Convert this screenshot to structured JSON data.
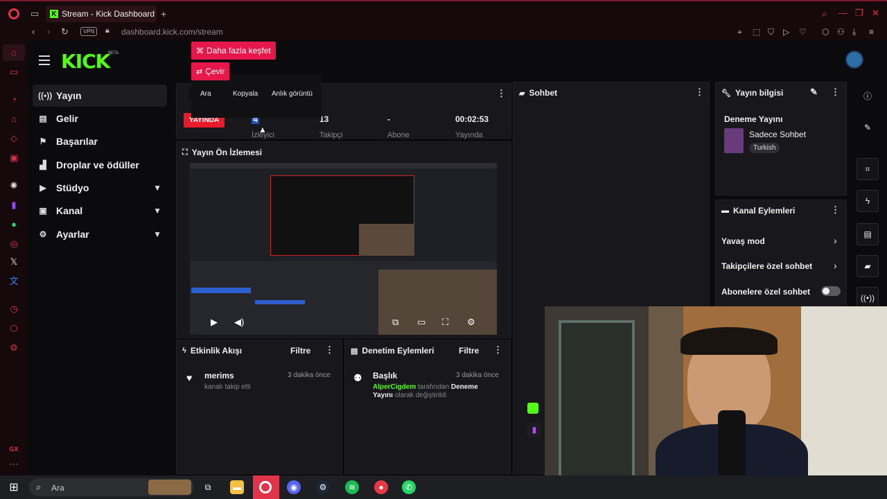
{
  "browser": {
    "tab_title": "Stream - Kick Dashboard",
    "tab_add": "+",
    "vpn_label": "VPN",
    "url": "dashboard.kick.com/stream"
  },
  "context_popup": {
    "explore_label": "Daha fazla keşfet",
    "translate_label": "Çevir",
    "search_label": "Ara",
    "copy_label": "Kopyala",
    "snapshot_label": "Anlık görüntü"
  },
  "kick": {
    "logo": "KICK",
    "beta": "BETA",
    "nav": [
      {
        "label": "Yayın",
        "icon": "broadcast-icon"
      },
      {
        "label": "Gelir",
        "icon": "chart-icon"
      },
      {
        "label": "Başarılar",
        "icon": "flag-icon"
      },
      {
        "label": "Droplar ve ödüller",
        "icon": "gift-icon"
      },
      {
        "label": "Stüdyo",
        "icon": "studio-icon"
      },
      {
        "label": "Kanal",
        "icon": "channel-icon"
      },
      {
        "label": "Ayarlar",
        "icon": "gear-icon"
      }
    ]
  },
  "stats": {
    "live_badge": "YAYINDA",
    "viewers_value": "4",
    "viewers_label": "İzleyici",
    "followers_value": "13",
    "followers_label": "Takipçi",
    "subs_value": "-",
    "subs_label": "Abone",
    "uptime_value": "00:02:53",
    "uptime_label": "Yayında"
  },
  "preview": {
    "title": "Yayın Ön İzlemesi"
  },
  "activity": {
    "title": "Etkinlik Akışı",
    "filter": "Filtre",
    "item_user": "merims",
    "item_action": "kanalı takip etti",
    "item_time": "3 dakika önce"
  },
  "moderation": {
    "title": "Denetim Eylemleri",
    "filter": "Filtre",
    "item_title": "Başlık",
    "item_time": "3 dakika önce",
    "item_user": "AlperCigdem",
    "item_by": "tarafından",
    "item_from": "Deneme",
    "item_new": "Yayını",
    "item_tail": "olarak değiştirildi"
  },
  "chat": {
    "title": "Sohbet"
  },
  "stream_info": {
    "title": "Yayın bilgisi",
    "stream_title": "Deneme Yayını",
    "category": "Sadece Sohbet",
    "language": "Turkish"
  },
  "channel_actions": {
    "title": "Kanal Eylemleri",
    "slow_mode": "Yavaş mod",
    "followers_only": "Takipçilere özel sohbet",
    "subs_only": "Abonelere özel sohbet",
    "subs_only_on": false
  },
  "taskbar": {
    "search_placeholder": "Ara"
  },
  "colors": {
    "kick_green": "#53fc18",
    "live_red": "#e81a2b",
    "opera_red": "#e0344a",
    "popup_pink": "#e6174a"
  }
}
